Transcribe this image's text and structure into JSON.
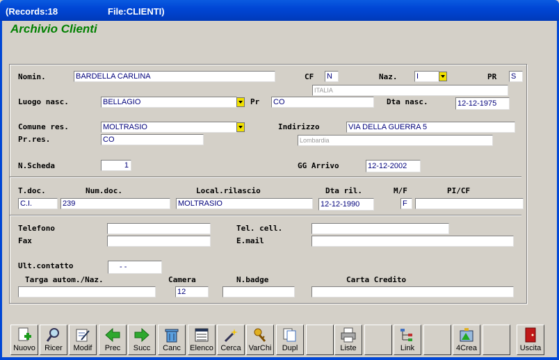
{
  "window": {
    "records": "(Records:18",
    "file": "File:CLIENTI)"
  },
  "app_title": "Archivio Clienti",
  "labels": {
    "nomin": "Nomin.",
    "cf": "CF",
    "naz": "Naz.",
    "pr": "PR",
    "luogo_nasc": "Luogo nasc.",
    "pr2": "Pr",
    "dta_nasc": "Dta nasc.",
    "comune_res": "Comune res.",
    "indirizzo": "Indirizzo",
    "pr_res": "Pr.res.",
    "n_scheda": "N.Scheda",
    "gg_arrivo": "GG Arrivo",
    "t_doc": "T.doc.",
    "num_doc": "Num.doc.",
    "local_rilascio": "Local.rilascio",
    "dta_ril": "Dta ril.",
    "mf": "M/F",
    "picf": "PI/CF",
    "telefono": "Telefono",
    "tel_cell": "Tel. cell.",
    "fax": "Fax",
    "email": "E.mail",
    "ult_contatto": "Ult.contatto",
    "targa": "Targa autom./Naz.",
    "camera": "Camera",
    "n_badge": "N.badge",
    "carta_credito": "Carta Credito"
  },
  "values": {
    "nomin": "BARDELLA CARLINA",
    "cf": "N",
    "naz": "I",
    "pr": "S",
    "naz_desc": "ITALIA",
    "luogo_nasc": "BELLAGIO",
    "pr2": "CO",
    "dta_nasc": "12-12-1975",
    "comune_res": "MOLTRASIO",
    "indirizzo": "VIA DELLA GUERRA 5",
    "pr_res": "CO",
    "regione": "Lombardia",
    "n_scheda": "1",
    "gg_arrivo": "12-12-2002",
    "t_doc": "C.I.",
    "num_doc": "239",
    "local_rilascio": "MOLTRASIO",
    "dta_ril": "12-12-1990",
    "mf": "F",
    "picf": "",
    "telefono": "",
    "tel_cell": "",
    "fax": "",
    "email": "",
    "ult_contatto": "-   -",
    "targa": "",
    "camera": "12",
    "n_badge": "",
    "carta_credito": ""
  },
  "toolbar": {
    "nuovo": "Nuovo",
    "ricer": "Ricer",
    "modif": "Modif",
    "prec": "Prec",
    "succ": "Succ",
    "canc": "Canc",
    "elenco": "Elenco",
    "cerca": "Cerca",
    "varchi": "VarChi",
    "dupl": "Dupl",
    "liste": "Liste",
    "link": "Link",
    "crea": "4Crea",
    "uscita": "Uscita"
  },
  "colors": {
    "title_green": "#008000",
    "value_blue": "#00007b",
    "dropdown_yellow": "#f0e000",
    "titlebar_blue": "#0046d5"
  }
}
